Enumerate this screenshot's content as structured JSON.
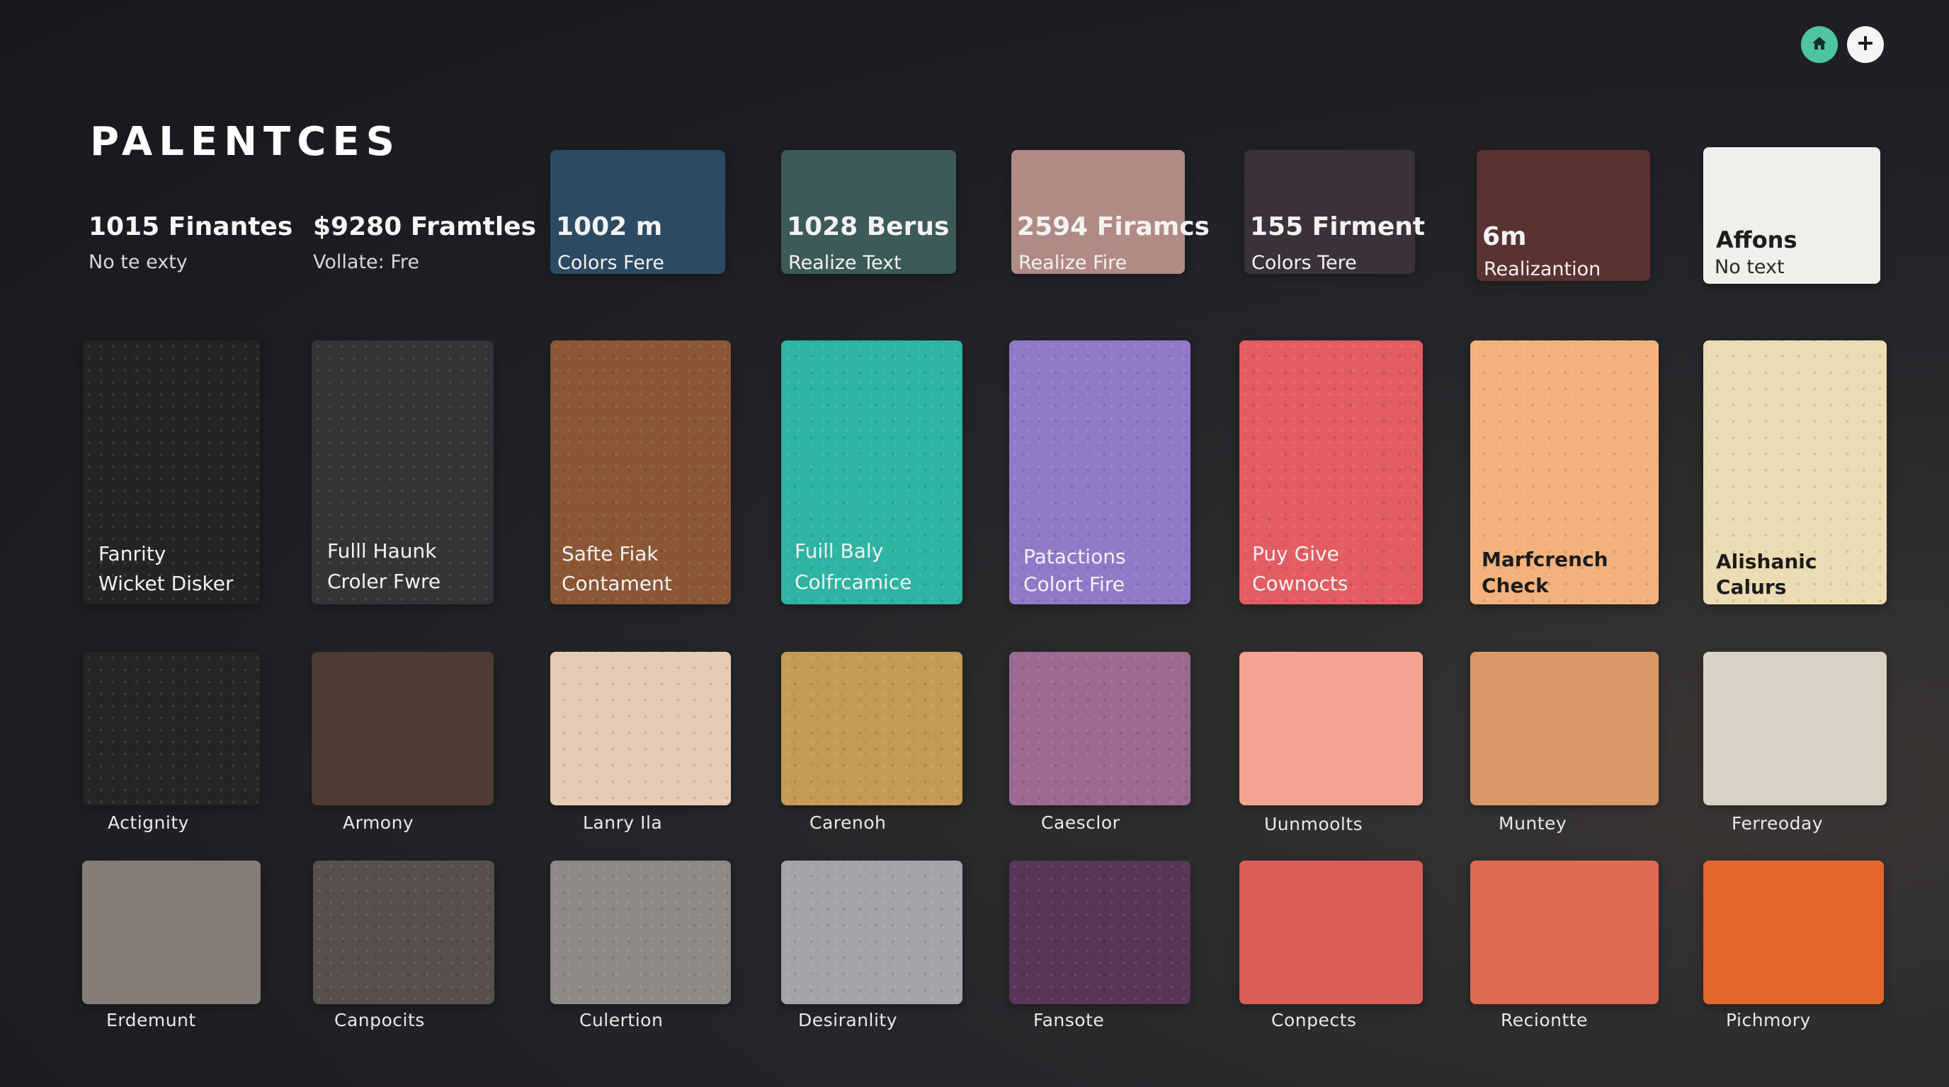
{
  "page": {
    "title": "PALENTCES"
  },
  "toolbar": {
    "home_icon": "home-icon",
    "add_icon": "plus-icon"
  },
  "stats": [
    {
      "title": "1015 Finantes",
      "subtitle": "No te exty"
    },
    {
      "title": "$9280 Framtles",
      "subtitle": "Vollate: Fre"
    }
  ],
  "top_cards": [
    {
      "title": "1002 m",
      "subtitle": "Colors Fere",
      "color": "#2d4a63"
    },
    {
      "title": "1028 Berus",
      "subtitle": "Realize Text",
      "color": "#3c5a58"
    },
    {
      "title": "2594 Firamcs",
      "subtitle": "Realize Fire",
      "color": "#b08a84"
    },
    {
      "title": "155 Firment",
      "subtitle": "Colors Tere",
      "color": "#3a3238"
    },
    {
      "title": "6m",
      "subtitle": "Realizantion",
      "color": "#5a3232"
    },
    {
      "title": "Affons",
      "subtitle": "No text",
      "color": "#efefec"
    }
  ],
  "tall_swatches": [
    {
      "line1": "Fanrity",
      "line2": "Wicket Disker",
      "color": "#242425"
    },
    {
      "line1": "Fulll Haunk",
      "line2": "Croler Fwre",
      "color": "#333436"
    },
    {
      "line1": "Safte Fiak",
      "line2": "Contament",
      "color": "#8a5634"
    },
    {
      "line1": "Fuill Baly",
      "line2": "Colfrcamice",
      "color": "#2fb3a2"
    },
    {
      "line1": "Patactions",
      "line2": "Colort Fire",
      "color": "#9179c9"
    },
    {
      "line1": "Puy Give",
      "line2": "Cownocts",
      "color": "#e25c62"
    },
    {
      "line1": "Marfcrench",
      "line2": "Check",
      "color": "#f3b27c"
    },
    {
      "line1": "Alishanic",
      "line2": "Calurs",
      "color": "#ecdcb3"
    }
  ],
  "row3": [
    {
      "name": "Actignity",
      "color": "#242525"
    },
    {
      "name": "Armony",
      "color": "#503b32"
    },
    {
      "name": "Lanry Ila",
      "color": "#e6cbb5"
    },
    {
      "name": "Carenoh",
      "color": "#c39b55"
    },
    {
      "name": "Caesclor",
      "color": "#9c6990"
    },
    {
      "name": "Uunmoolts",
      "color": "#f3a390"
    },
    {
      "name": "Muntey",
      "color": "#d99865"
    },
    {
      "name": "Ferreoday",
      "color": "#d8d2c4"
    }
  ],
  "row4": [
    {
      "name": "Erdemunt",
      "color": "#857b77"
    },
    {
      "name": "Canpocits",
      "color": "#57504c"
    },
    {
      "name": "Culertion",
      "color": "#8d8986"
    },
    {
      "name": "Desiranlity",
      "color": "#a3a3a8"
    },
    {
      "name": "Fansote",
      "color": "#573657"
    },
    {
      "name": "Conpects",
      "color": "#db5d58"
    },
    {
      "name": "Reciontte",
      "color": "#de6a52"
    },
    {
      "name": "Pichmory",
      "color": "#e2652a"
    }
  ]
}
